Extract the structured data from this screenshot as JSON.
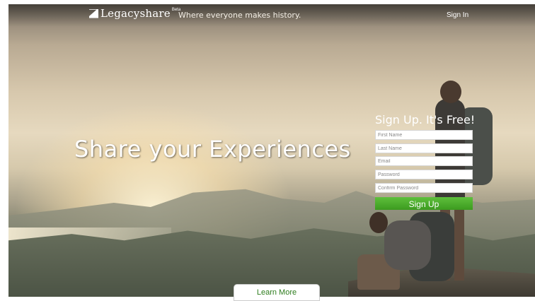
{
  "header": {
    "logo_text": "Legacyshare",
    "beta": "Beta",
    "tagline": "Where everyone makes history.",
    "signin_label": "Sign In"
  },
  "hero": {
    "headline": "Share your Experiences"
  },
  "signup": {
    "title": "Sign Up. It's Free!",
    "first_name_placeholder": "First Name",
    "last_name_placeholder": "Last Name",
    "email_placeholder": "Email",
    "password_placeholder": "Password",
    "confirm_password_placeholder": "Confirm Password",
    "button_label": "Sign Up"
  },
  "footer": {
    "learn_more_label": "Learn More"
  }
}
